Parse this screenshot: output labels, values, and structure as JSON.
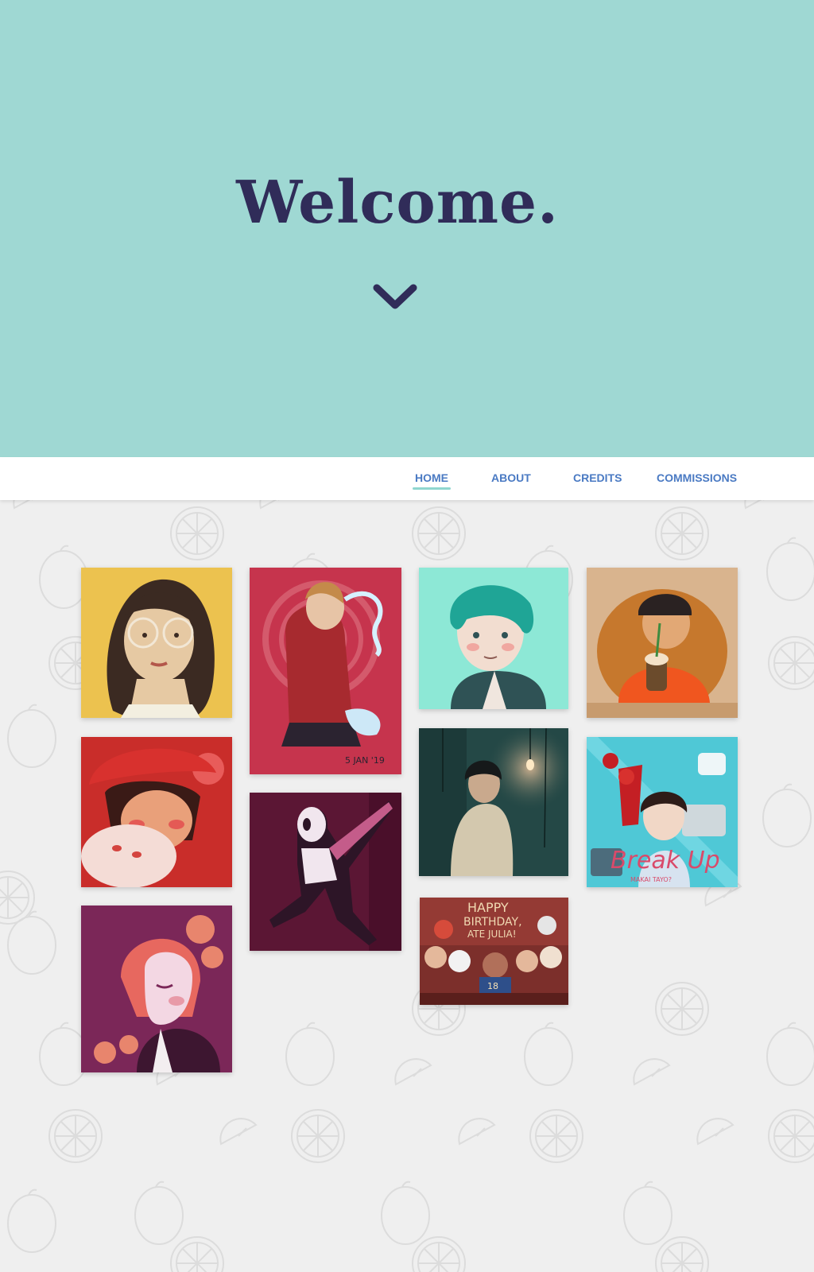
{
  "hero": {
    "title": "Welcome.",
    "scroll_icon": "chevron-down-icon",
    "background": "#9fd8d3",
    "title_color": "#302c59"
  },
  "nav": {
    "items": [
      {
        "label": "HOME",
        "active": true
      },
      {
        "label": "ABOUT",
        "active": false
      },
      {
        "label": "CREDITS",
        "active": false
      },
      {
        "label": "COMMISSIONS",
        "active": false
      }
    ],
    "color": "#4a7ac3",
    "active_underline": "#8fd6cf"
  },
  "gallery": {
    "artwork_7_signature": "5 JAN '19",
    "artwork_9_line1": "HAPPY",
    "artwork_9_line2": "BIRTHDAY,",
    "artwork_9_line3": "ATE JULIA!",
    "artwork_9_number": "18",
    "artwork_10_title": "Break Up",
    "artwork_10_subtitle": "MAKAI TAYO?"
  }
}
